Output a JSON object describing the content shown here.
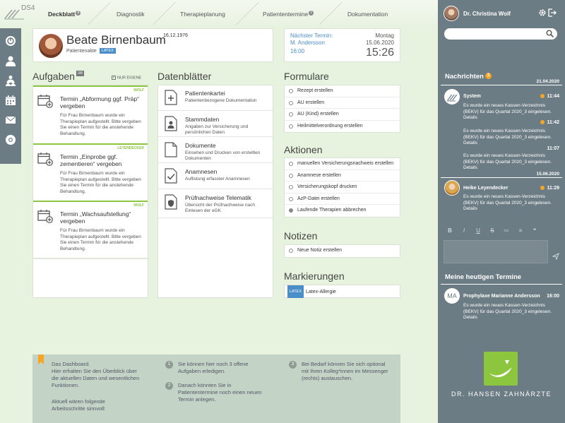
{
  "app": {
    "logo_text": "DS4"
  },
  "nav": {
    "tabs": [
      {
        "label": "Deckblatt",
        "badge": "3"
      },
      {
        "label": "Diagnostik"
      },
      {
        "label": "Therapieplanung"
      },
      {
        "label": "Patiententermine",
        "badge": "1"
      },
      {
        "label": "Dokumentation"
      }
    ]
  },
  "patient": {
    "name": "Beate Birnenbaum",
    "dob": "16.12.1976",
    "subtitle": "Patientenakte",
    "badge": "LATEX"
  },
  "next_appointment": {
    "label": "Nächster Termin:",
    "with": "M. Andersson",
    "time": "16:00",
    "weekday": "Montag",
    "date": "15.06.2020",
    "clock": "15:26"
  },
  "tasks": {
    "title": "Aufgaben",
    "count": "3/8",
    "filter_label": "NUR EIGENE",
    "items": [
      {
        "owner": "WOLF",
        "title": "Termin „Abformung ggf. Präp“ vergeben",
        "desc": "Für Frau Birnenbaum wurde ein Therapieplan aufgestellt. Bitte vergeben Sie einen Termin für die anstehende Behandlung."
      },
      {
        "owner": "LEYENDECKER",
        "title": "Termin „Einprobe ggf. zementieren“ vergeben",
        "desc": "Für Frau Birnenbaum wurde ein Therapieplan aufgestellt. Bitte vergeben Sie einen Termin für die anstehende Behandlung."
      },
      {
        "owner": "WOLF",
        "title": "Termin „Wachsaufstellung“ vergeben",
        "desc": "Für Frau Birnenbaum wurde ein Therapieplan aufgestellt. Bitte vergeben Sie einen Termin für die anstehende Behandlung."
      }
    ]
  },
  "sheets": {
    "title": "Datenblätter",
    "items": [
      {
        "title": "Patientenkartei",
        "desc": "Patientenbezogene Dokumentation",
        "icon": "plus-document-icon"
      },
      {
        "title": "Stammdaten",
        "desc": "Angaben zur Versicherung und persönlichen Daten",
        "icon": "person-document-icon"
      },
      {
        "title": "Dokumente",
        "desc": "Einsehen und Drucken von erstellten Dokumenten",
        "icon": "document-icon"
      },
      {
        "title": "Anamnesen",
        "desc": "Auflistung erfasster Anamnesen",
        "icon": "checkmark-document-icon"
      },
      {
        "title": "Prüfnachweise Telematik",
        "desc": "Übersicht der Prüfnachweise nach Einlesen der eGK",
        "icon": "shield-document-icon"
      }
    ]
  },
  "forms": {
    "title": "Formulare",
    "items": [
      "Rezept erstellen",
      "AU erstellen",
      "AU (Kind) erstellen",
      "Heilmittelverordnung erstellen"
    ]
  },
  "actions": {
    "title": "Aktionen",
    "items": [
      "manuellen Versicherungsnachweis erstellen",
      "Anamnese erstellen",
      "Versicherungskopf drucken",
      "AzP-Datei erstellen",
      "Laufende Therapien abbrechen"
    ]
  },
  "notes": {
    "title": "Notizen",
    "items": [
      "Neue Notiz erstellen"
    ]
  },
  "markings": {
    "title": "Markierungen",
    "badge": "LATEX",
    "label": "Latex-Allergie"
  },
  "info": {
    "intro": "Das Dashboard.\nHier erhalten Sie den Überblick über die aktuellen Daten und wesentlichen Funktionen.",
    "intro2": "Aktuell wären folgende Arbeitsschritte sinnvoll:",
    "steps": [
      {
        "num": "1",
        "text": "Sie können hier noch 3 offene Aufgaben erledigen."
      },
      {
        "num": "2",
        "text": "Danach könnten Sie in Patiententermine noch einen neuen Termin anlegen."
      },
      {
        "num": "3",
        "text": "Bei Bedarf können Sie sich optional mit Ihren Kolleg*innen im Messenger (rechts) austauschen."
      }
    ]
  },
  "sidebar": {
    "user_name": "Dr. Christina Wolf",
    "search_placeholder": "",
    "messages_title": "Nachrichten",
    "messages_badge": "3",
    "groups": [
      {
        "date": "21.04.2020",
        "sender": "System",
        "messages": [
          {
            "time": "11:44",
            "unread": true,
            "text": "Es wurde ein neues Kassen-Verzeichnis (BEKV) für das Quartal 2020_3 eingelesen. Details"
          },
          {
            "time": "11:42",
            "unread": true,
            "text": "Es wurde ein neues Kassen-Verzeichnis (BEKV) für das Quartal 2020_3 eingelesen. Details"
          },
          {
            "time": "11:07",
            "unread": false,
            "text": "Es wurde ein neues Kassen-Verzeichnis (BEKV) für das Quartal 2020_3 eingelesen. Details"
          }
        ]
      },
      {
        "date": "15.06.2020",
        "sender": "Heike Leyendecker",
        "messages": [
          {
            "time": "11:29",
            "unread": true,
            "text": "Es wurde ein neues Kassen-Verzeichnis (BEKV) für das Quartal 2020_3 eingelesen. Details"
          }
        ]
      }
    ],
    "toolbar": [
      "B",
      "I",
      "U",
      "S",
      "≔",
      "≡",
      "❝"
    ],
    "appointments_title": "Meine heutigen Termine",
    "appointments": [
      {
        "initials": "MA",
        "title": "Prophylaxe Marianne Andersson",
        "time": "16:00",
        "text": "Es wurde ein neues Kassen-Verzeichnis (BEKV) für das Quartal 2020_3 eingelesen. Details"
      }
    ],
    "brand": "DR. HANSEN ZAHNÄRZTE"
  },
  "colors": {
    "accent_green": "#8cc63e",
    "accent_blue": "#4a8ec9",
    "accent_orange": "#f6a623",
    "sidebar_bg": "#6c7c84"
  }
}
